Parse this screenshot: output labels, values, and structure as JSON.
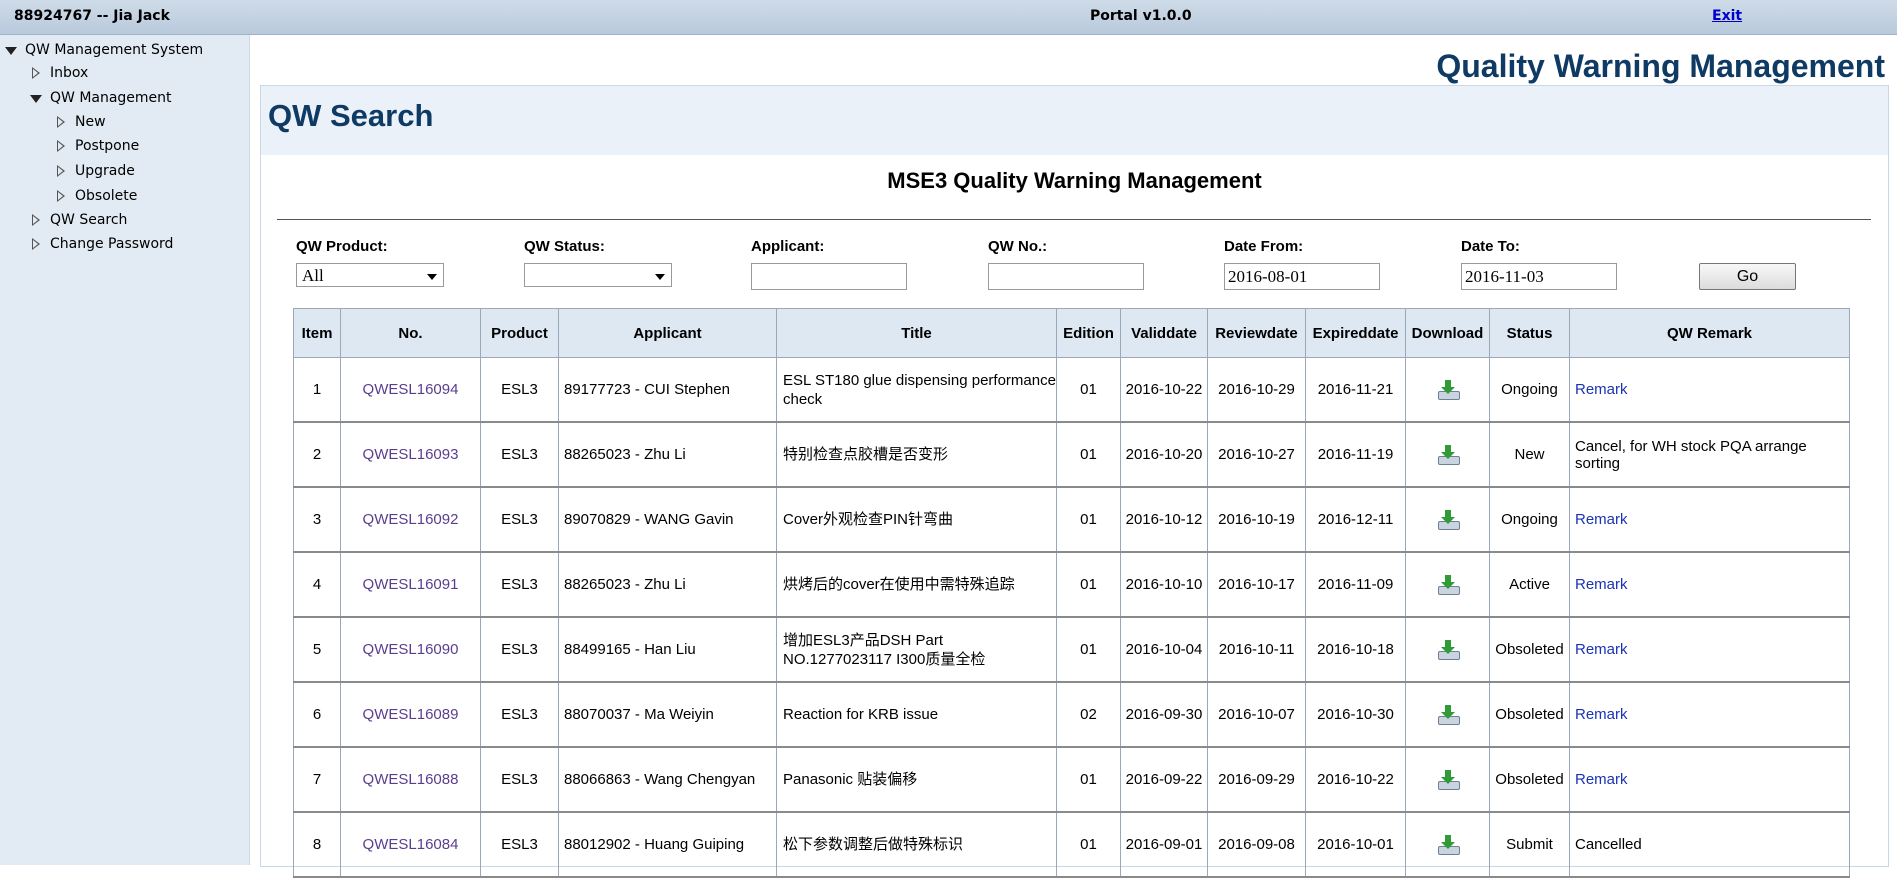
{
  "topbar": {
    "user": "88924767 -- Jia Jack",
    "portal": "Portal v1.0.0",
    "exit": "Exit"
  },
  "sidebar": {
    "root": "QW Management System",
    "items": [
      {
        "label": "Inbox"
      },
      {
        "label": "QW Management"
      },
      {
        "label": "New"
      },
      {
        "label": "Postpone"
      },
      {
        "label": "Upgrade"
      },
      {
        "label": "Obsolete"
      },
      {
        "label": "QW Search"
      },
      {
        "label": "Change Password"
      }
    ]
  },
  "main": {
    "title": "Quality Warning Management",
    "panel_title": "QW Search",
    "sub_title": "MSE3 Quality Warning Management"
  },
  "filters": {
    "product_label": "QW Product:",
    "product_value": "All",
    "status_label": "QW Status:",
    "status_value": "",
    "applicant_label": "Applicant:",
    "applicant_value": "",
    "qwno_label": "QW No.:",
    "qwno_value": "",
    "date_from_label": "Date From:",
    "date_from_value": "2016-08-01",
    "date_to_label": "Date To:",
    "date_to_value": "2016-11-03",
    "go_label": "Go"
  },
  "table": {
    "headers": [
      "Item",
      "No.",
      "Product",
      "Applicant",
      "Title",
      "Edition",
      "Validdate",
      "Reviewdate",
      "Expireddate",
      "Download",
      "Status",
      "QW Remark"
    ],
    "rows": [
      {
        "item": "1",
        "no": "QWESL16094",
        "product": "ESL3",
        "applicant": "89177723 - CUI Stephen",
        "title": "ESL ST180 glue dispensing performance check",
        "edition": "01",
        "valid": "2016-10-22",
        "review": "2016-10-29",
        "expired": "2016-11-21",
        "status": "Ongoing",
        "remark": "Remark",
        "remark_is_link": true
      },
      {
        "item": "2",
        "no": "QWESL16093",
        "product": "ESL3",
        "applicant": "88265023 - Zhu Li",
        "title": "特别检查点胶槽是否变形",
        "edition": "01",
        "valid": "2016-10-20",
        "review": "2016-10-27",
        "expired": "2016-11-19",
        "status": "New",
        "remark": "Cancel, for WH stock PQA arrange sorting",
        "remark_is_link": false
      },
      {
        "item": "3",
        "no": "QWESL16092",
        "product": "ESL3",
        "applicant": "89070829 - WANG Gavin",
        "title": "Cover外观检查PIN针弯曲",
        "edition": "01",
        "valid": "2016-10-12",
        "review": "2016-10-19",
        "expired": "2016-12-11",
        "status": "Ongoing",
        "remark": "Remark",
        "remark_is_link": true
      },
      {
        "item": "4",
        "no": "QWESL16091",
        "product": "ESL3",
        "applicant": "88265023 - Zhu Li",
        "title": "烘烤后的cover在使用中需特殊追踪",
        "edition": "01",
        "valid": "2016-10-10",
        "review": "2016-10-17",
        "expired": "2016-11-09",
        "status": "Active",
        "remark": "Remark",
        "remark_is_link": true
      },
      {
        "item": "5",
        "no": "QWESL16090",
        "product": "ESL3",
        "applicant": "88499165 - Han Liu",
        "title": "增加ESL3产品DSH Part NO.1277023117 I300质量全检",
        "edition": "01",
        "valid": "2016-10-04",
        "review": "2016-10-11",
        "expired": "2016-10-18",
        "status": "Obsoleted",
        "remark": "Remark",
        "remark_is_link": true
      },
      {
        "item": "6",
        "no": "QWESL16089",
        "product": "ESL3",
        "applicant": "88070037 - Ma Weiyin",
        "title": "Reaction for KRB issue",
        "edition": "02",
        "valid": "2016-09-30",
        "review": "2016-10-07",
        "expired": "2016-10-30",
        "status": "Obsoleted",
        "remark": "Remark",
        "remark_is_link": true
      },
      {
        "item": "7",
        "no": "QWESL16088",
        "product": "ESL3",
        "applicant": "88066863 - Wang Chengyan",
        "title": "Panasonic 贴装偏移",
        "edition": "01",
        "valid": "2016-09-22",
        "review": "2016-09-29",
        "expired": "2016-10-22",
        "status": "Obsoleted",
        "remark": "Remark",
        "remark_is_link": true
      },
      {
        "item": "8",
        "no": "QWESL16084",
        "product": "ESL3",
        "applicant": "88012902 - Huang Guiping",
        "title": "松下参数调整后做特殊标识",
        "edition": "01",
        "valid": "2016-09-01",
        "review": "2016-09-08",
        "expired": "2016-10-01",
        "status": "Submit",
        "remark": "Cancelled",
        "remark_is_link": false
      }
    ]
  }
}
